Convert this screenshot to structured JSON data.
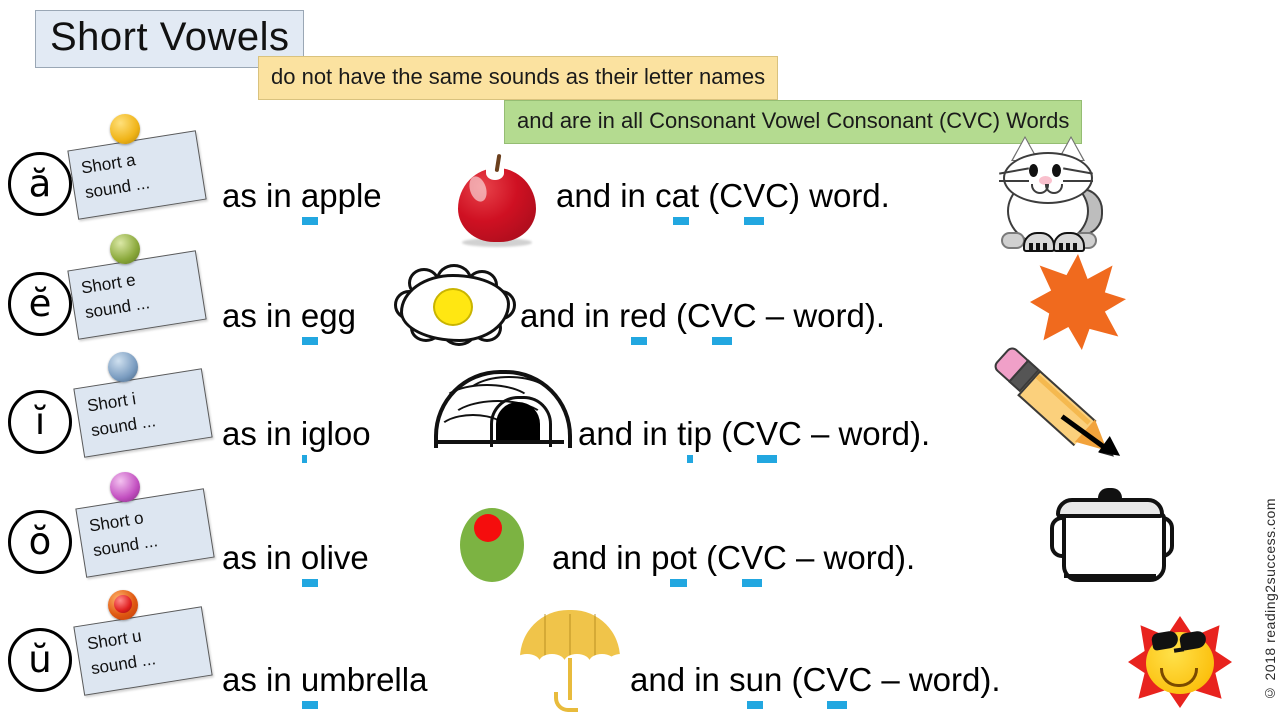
{
  "header": {
    "title": "Short Vowels",
    "banner_yellow": "do not have the same sounds as their letter names",
    "banner_green": "and are in all Consonant Vowel Consonant (CVC) Words"
  },
  "rows": [
    {
      "vowel_symbol": "ă",
      "note_line1": "Short a",
      "note_line2": "sound ...",
      "pin_color": "#f0b418",
      "example_prefix": "as in ",
      "example_word_pre": "",
      "example_word_vowel": "a",
      "example_word_post": "pple",
      "picture": "apple",
      "tail_pre": "and in c",
      "tail_vowel": "a",
      "tail_post": "t (C",
      "tail_vowel2": "V",
      "tail_end": "C) word.",
      "end_picture": "cat"
    },
    {
      "vowel_symbol": "ĕ",
      "note_line1": "Short e",
      "note_line2": "sound ...",
      "pin_color": "#8aa83a",
      "example_prefix": "as in ",
      "example_word_pre": "",
      "example_word_vowel": "e",
      "example_word_post": "gg",
      "picture": "egg",
      "tail_pre": "and in  r",
      "tail_vowel": "e",
      "tail_post": "d  (C",
      "tail_vowel2": "V",
      "tail_end": "C – word).",
      "end_picture": "starburst"
    },
    {
      "vowel_symbol": "ĭ",
      "note_line1": "Short i",
      "note_line2": "sound ...",
      "pin_color": "#7a9cc0",
      "example_prefix": "as in  ",
      "example_word_pre": "",
      "example_word_vowel": "i",
      "example_word_post": "gloo",
      "picture": "igloo",
      "tail_pre": "and  in  t",
      "tail_vowel": "i",
      "tail_post": "p  (C",
      "tail_vowel2": "V",
      "tail_end": "C – word).",
      "end_picture": "pencil"
    },
    {
      "vowel_symbol": "ŏ",
      "note_line1": "Short o",
      "note_line2": "sound ...",
      "pin_color": "#c24fc0",
      "example_prefix": "as  in  ",
      "example_word_pre": "",
      "example_word_vowel": "o",
      "example_word_post": "live",
      "picture": "olive",
      "tail_pre": "and  in  p",
      "tail_vowel": "o",
      "tail_post": "t  (C",
      "tail_vowel2": "V",
      "tail_end": "C – word).",
      "end_picture": "pot"
    },
    {
      "vowel_symbol": "ŭ",
      "note_line1": "Short u",
      "note_line2": "sound ...",
      "pin_color": "#e02020",
      "example_prefix": "as  in  ",
      "example_word_pre": "",
      "example_word_vowel": "u",
      "example_word_post": "mbrella",
      "picture": "umbrella",
      "tail_pre": "and  in  s",
      "tail_vowel": "u",
      "tail_post": "n  (C",
      "tail_vowel2": "V",
      "tail_end": "C – word).",
      "end_picture": "sun"
    }
  ],
  "footer": {
    "copyright": "© 2018 reading2success.com"
  },
  "colors": {
    "title_bg": "#e2eaf4",
    "banner_yellow_bg": "#fbe2a0",
    "banner_green_bg": "#b4db90",
    "note_bg": "#dde6f1",
    "underline_highlight": "#22a7e0"
  }
}
